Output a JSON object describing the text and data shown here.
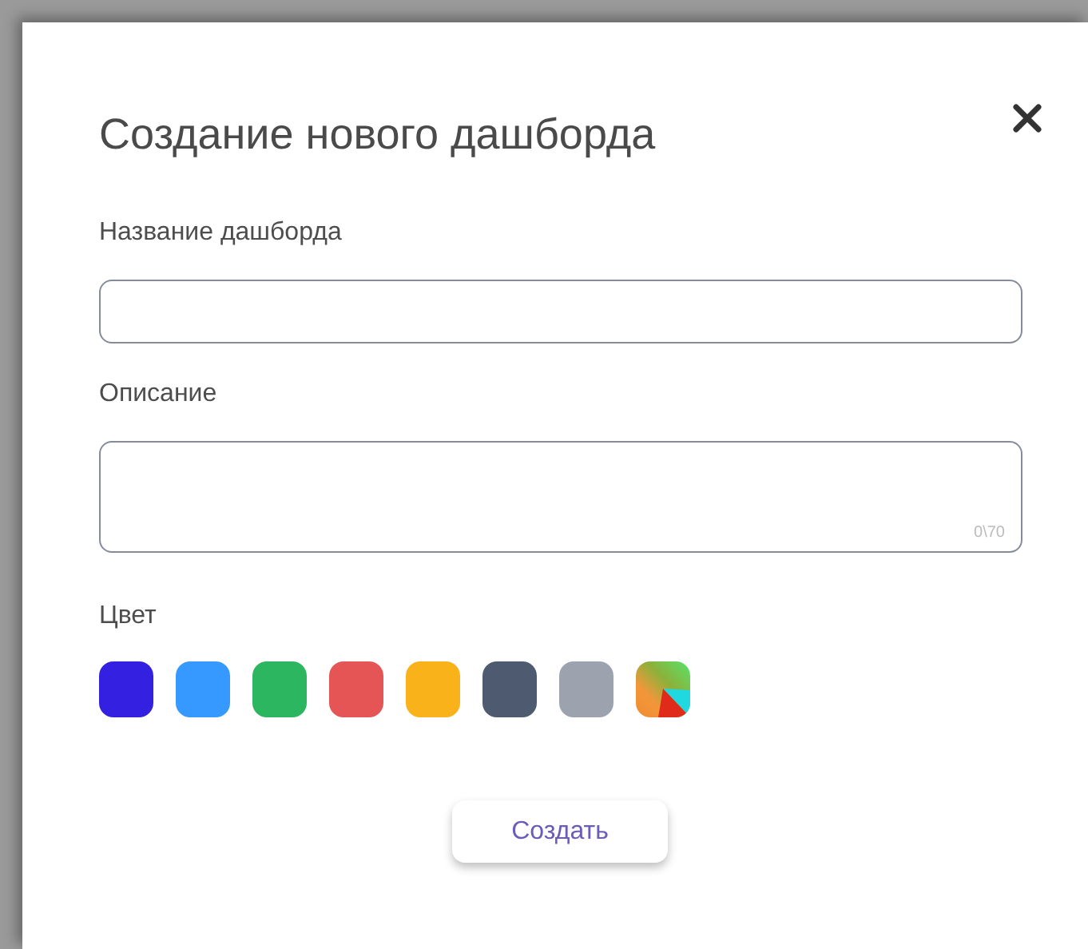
{
  "dialog": {
    "title": "Создание нового дашборда",
    "fields": [
      {
        "label": "Название дашборда",
        "kind": "input"
      },
      {
        "label": "Описание",
        "kind": "textarea",
        "counter": "0\\70"
      }
    ],
    "color_label": "Цвет",
    "swatches": [
      {
        "kind": "solid",
        "color": "#3420e0"
      },
      {
        "kind": "solid",
        "color": "#3699ff"
      },
      {
        "kind": "solid",
        "color": "#2cb65f"
      },
      {
        "kind": "solid",
        "color": "#e55555"
      },
      {
        "kind": "solid",
        "color": "#fab21a"
      },
      {
        "kind": "solid",
        "color": "#4e5a70"
      },
      {
        "kind": "solid",
        "color": "#9ca3ae"
      },
      {
        "kind": "gradient"
      }
    ],
    "button": "Создать"
  }
}
